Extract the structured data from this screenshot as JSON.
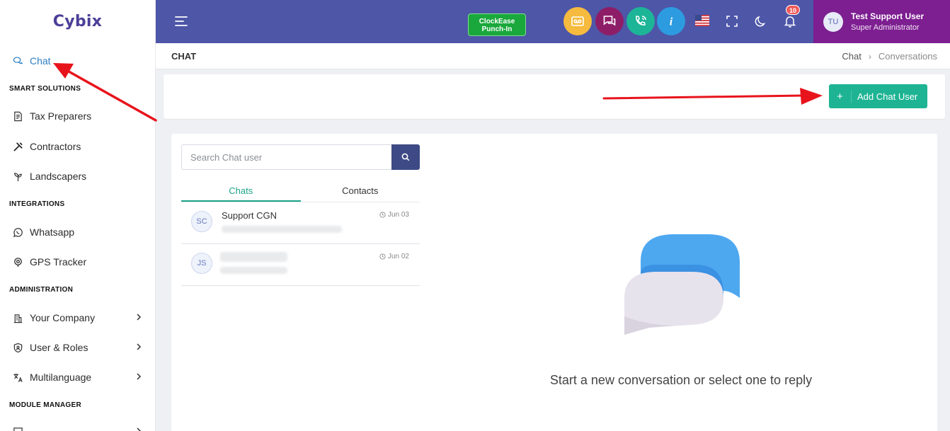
{
  "brand": {
    "logo_text": "Cybix"
  },
  "sidebar": {
    "items": [
      {
        "label": "Chat",
        "icon": "chat-icon",
        "active": true
      },
      {
        "label": "Tax Preparers",
        "icon": "document-icon"
      },
      {
        "label": "Contractors",
        "icon": "tools-icon"
      },
      {
        "label": "Landscapers",
        "icon": "plant-icon"
      },
      {
        "label": "Whatsapp",
        "icon": "whatsapp-icon"
      },
      {
        "label": "GPS Tracker",
        "icon": "location-icon"
      },
      {
        "label": "Your Company",
        "icon": "building-icon",
        "chevron": true
      },
      {
        "label": "User & Roles",
        "icon": "shield-icon",
        "chevron": true
      },
      {
        "label": "Multilanguage",
        "icon": "translate-icon",
        "chevron": true
      }
    ],
    "sections": {
      "smart": "SMART SOLUTIONS",
      "integrations": "INTEGRATIONS",
      "administration": "ADMINISTRATION",
      "module_manager": "MODULE MANAGER"
    }
  },
  "topbar": {
    "punch_line1": "ClockEase",
    "punch_line2": "Punch-In",
    "notification_count": "10",
    "user_initials": "TU",
    "user_name": "Test Support User",
    "user_role": "Super Administrator",
    "colors": {
      "bar": "#4e56a8",
      "user_box": "#7d1e91",
      "punch": "#1aa83c"
    }
  },
  "page": {
    "title": "CHAT",
    "breadcrumb": [
      "Chat",
      "Conversations"
    ]
  },
  "actions": {
    "add_chat_user": "Add Chat User"
  },
  "chat": {
    "search_placeholder": "Search Chat user",
    "tabs": [
      "Chats",
      "Contacts"
    ],
    "conversations": [
      {
        "initials": "SC",
        "name": "Support CGN",
        "date": "Jun 03"
      },
      {
        "initials": "JS",
        "name": "",
        "date": "Jun 02"
      }
    ],
    "empty_message": "Start a new conversation or select one to reply"
  }
}
